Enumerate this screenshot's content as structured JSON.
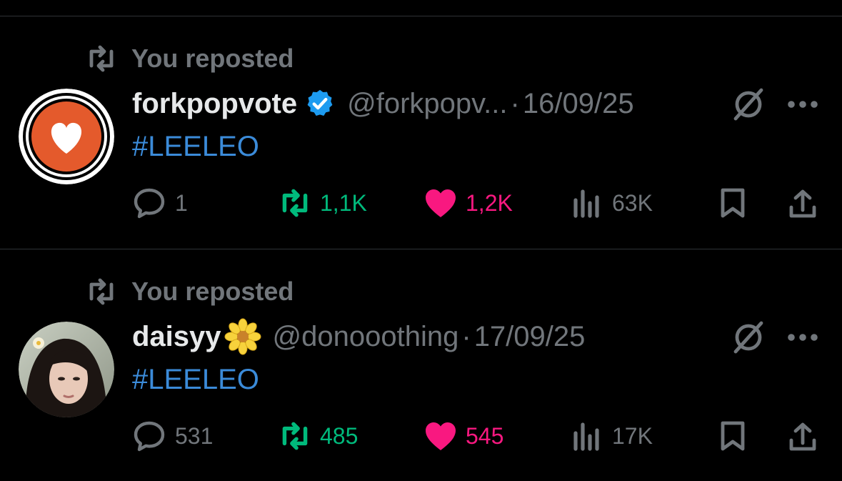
{
  "posts": [
    {
      "repost_label": "You reposted",
      "display_name": "forkpopvote",
      "verified": true,
      "handle": "@forkpopv...",
      "separator": "·",
      "date": "16/09/25",
      "text": "#LEELEO",
      "avatar": "heart-logo-avatar",
      "stats": {
        "replies": "1",
        "reposts": "1,1K",
        "likes": "1,2K",
        "views": "63K"
      },
      "liked": true,
      "reposted": true
    },
    {
      "repost_label": "You reposted",
      "display_name": "daisyy",
      "name_emoji": "daisy-emoji",
      "handle": "@donooothing",
      "separator": "·",
      "date": "17/09/25",
      "text": "#LEELEO",
      "avatar": "profile-photo-avatar",
      "stats": {
        "replies": "531",
        "reposts": "485",
        "likes": "545",
        "views": "17K"
      },
      "liked": true,
      "reposted": true
    }
  ],
  "colors": {
    "background": "#000000",
    "text_primary": "#e7e9ea",
    "text_secondary": "#71767b",
    "hashtag": "#3b8bd9",
    "repost_active": "#00ba7c",
    "like_active": "#f91880",
    "verified": "#1d9bf0",
    "divider": "#2f3336"
  }
}
